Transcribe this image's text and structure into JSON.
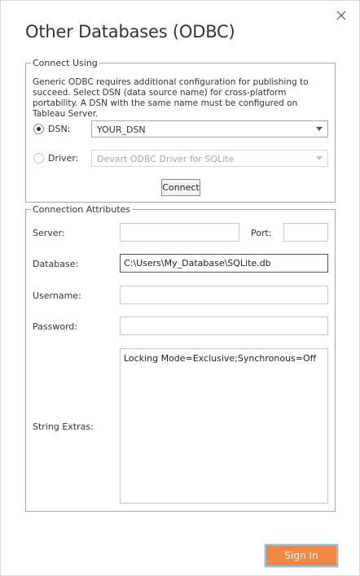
{
  "dialog": {
    "title": "Other Databases (ODBC)"
  },
  "connect_using": {
    "legend": "Connect Using",
    "description": "Generic ODBC requires additional configuration for publishing to succeed. Select DSN (data source name) for cross-platform portability. A DSN with the same name must be configured on Tableau Server.",
    "dsn_label": "DSN:",
    "dsn_value": "YOUR_DSN",
    "dsn_selected": true,
    "driver_label": "Driver:",
    "driver_value": "Devart ODBC Driver for SQLite",
    "driver_selected": false,
    "connect_button": "Connect"
  },
  "connection_attributes": {
    "legend": "Connection Attributes",
    "server_label": "Server:",
    "server_value": "",
    "port_label": "Port:",
    "port_value": "",
    "database_label": "Database:",
    "database_value": "C:\\Users\\My_Database\\SQLite.db",
    "username_label": "Username:",
    "username_value": "",
    "password_label": "Password:",
    "password_value": "",
    "string_extras_label": "String Extras:",
    "string_extras_value": "Locking Mode=Exclusive;Synchronous=Off"
  },
  "footer": {
    "sign_in_button": "Sign In"
  },
  "colors": {
    "accent": "#f0883f",
    "focus_ring": "#8fc0e4",
    "border": "#a6a6a6"
  },
  "icons": {
    "close": "close-icon",
    "dropdown": "chevron-down-icon"
  }
}
